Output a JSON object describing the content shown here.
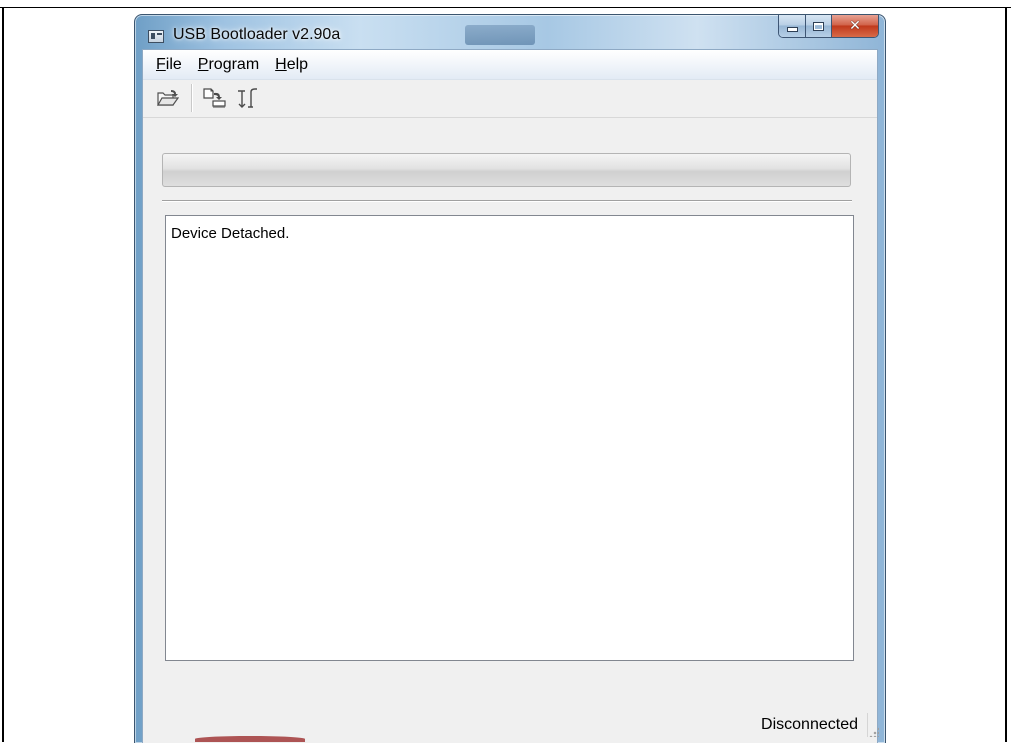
{
  "window": {
    "title": "USB Bootloader v2.90a",
    "app_icon": "app-window-icon",
    "caption_buttons": [
      "minimize-icon",
      "maximize-icon",
      "close-icon"
    ]
  },
  "menu": {
    "items": [
      {
        "mnemonic": "F",
        "rest": "ile"
      },
      {
        "mnemonic": "P",
        "rest": "rogram"
      },
      {
        "mnemonic": "H",
        "rest": "elp"
      }
    ]
  },
  "toolbar": {
    "buttons": [
      "open-folder-icon",
      "program-device-icon",
      "reset-device-icon"
    ]
  },
  "progress": {
    "value": 0
  },
  "log": {
    "text": "Device Detached."
  },
  "status": {
    "text": "Disconnected"
  },
  "colors": {
    "close_button": "#c0391c",
    "client_background": "#f0f0f0",
    "aero_frame": "#9fc3e2"
  }
}
